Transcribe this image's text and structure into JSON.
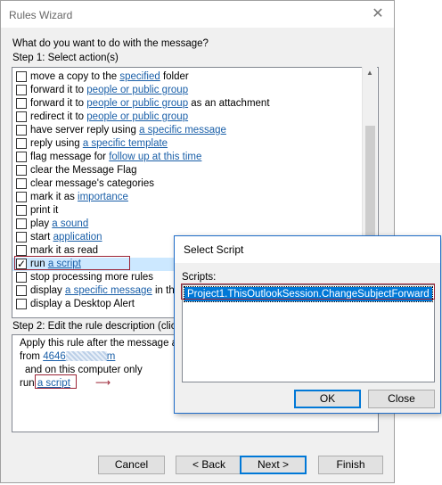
{
  "wizard": {
    "title": "Rules Wizard",
    "close_glyph": "✕",
    "question": "What do you want to do with the message?",
    "step1_label": "Step 1: Select action(s)",
    "actions": [
      {
        "pre": "move a copy to the ",
        "link": "specified",
        "post": " folder",
        "checked": false
      },
      {
        "pre": "forward it to ",
        "link": "people or public group",
        "post": "",
        "checked": false
      },
      {
        "pre": "forward it to ",
        "link": "people or public group",
        "post": " as an attachment",
        "checked": false
      },
      {
        "pre": "redirect it to ",
        "link": "people or public group",
        "post": "",
        "checked": false
      },
      {
        "pre": "have server reply using ",
        "link": "a specific message",
        "post": "",
        "checked": false
      },
      {
        "pre": "reply using ",
        "link": "a specific template",
        "post": "",
        "checked": false
      },
      {
        "pre": "flag message for ",
        "link": "follow up at this time",
        "post": "",
        "checked": false
      },
      {
        "pre": "clear the Message Flag",
        "link": "",
        "post": "",
        "checked": false
      },
      {
        "pre": "clear message's categories",
        "link": "",
        "post": "",
        "checked": false
      },
      {
        "pre": "mark it as ",
        "link": "importance",
        "post": "",
        "checked": false
      },
      {
        "pre": "print it",
        "link": "",
        "post": "",
        "checked": false
      },
      {
        "pre": "play ",
        "link": "a sound",
        "post": "",
        "checked": false
      },
      {
        "pre": "start ",
        "link": "application",
        "post": "",
        "checked": false
      },
      {
        "pre": "mark it as read",
        "link": "",
        "post": "",
        "checked": false
      },
      {
        "pre": "run ",
        "link": "a script",
        "post": "",
        "checked": true,
        "selected": true
      },
      {
        "pre": "stop processing more rules",
        "link": "",
        "post": "",
        "checked": false
      },
      {
        "pre": "display ",
        "link": "a specific message",
        "post": " in the",
        "checked": false
      },
      {
        "pre": "display a Desktop Alert",
        "link": "",
        "post": "",
        "checked": false
      }
    ],
    "step2_label": "Step 2: Edit the rule description (clic",
    "description": {
      "line1": "Apply this rule after the message a",
      "line2_pre": "from ",
      "line2_link_a": "4646",
      "line2_link_b": "m",
      "line3": "and on this computer only",
      "line4_pre": "run ",
      "line4_link": "a script",
      "arrow": "⟶"
    },
    "buttons": {
      "cancel": "Cancel",
      "back": "< Back",
      "next": "Next >",
      "finish": "Finish"
    }
  },
  "select_script": {
    "title": "Select Script",
    "scripts_label": "Scripts:",
    "scripts": [
      "Project1.ThisOutlookSession.ChangeSubjectForward"
    ],
    "ok": "OK",
    "close": "Close"
  },
  "colors": {
    "accent": "#0078d7",
    "link": "#1a5fa8",
    "highlight_frame": "#9b2335"
  }
}
